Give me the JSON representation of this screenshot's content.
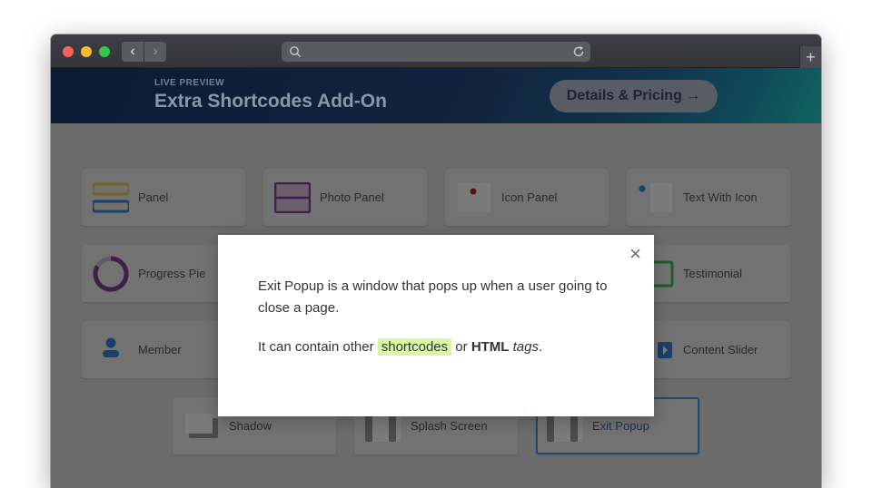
{
  "browser": {
    "nav_back": "‹",
    "nav_forward": "›",
    "new_tab": "+",
    "url_value": ""
  },
  "banner": {
    "kicker": "LIVE PREVIEW",
    "title": "Extra Shortcodes Add-On",
    "button_label": "Details & Pricing →"
  },
  "shortcodes": [
    {
      "label": "Panel",
      "icon": "panel-icon"
    },
    {
      "label": "Photo Panel",
      "icon": "photo-panel-icon"
    },
    {
      "label": "Icon Panel",
      "icon": "icon-panel-icon"
    },
    {
      "label": "Text With Icon",
      "icon": "text-with-icon-icon"
    },
    {
      "label": "Progress Pie",
      "icon": "progress-pie-icon"
    },
    {
      "label": "Testimonial",
      "icon": "testimonial-icon"
    },
    {
      "label": "Member",
      "icon": "member-icon"
    },
    {
      "label": "Content Slider",
      "icon": "content-slider-icon"
    },
    {
      "label": "Shadow",
      "icon": "shadow-icon"
    },
    {
      "label": "Splash Screen",
      "icon": "splash-screen-icon"
    },
    {
      "label": "Exit Popup",
      "icon": "exit-popup-icon",
      "active": true
    }
  ],
  "modal": {
    "close": "×",
    "p1": "Exit Popup is a window that pops up when a user going to close a page.",
    "p2_prefix": "It can contain other ",
    "p2_highlight": "shortcodes",
    "p2_mid": " or ",
    "p2_bold": "HTML",
    "p2_space": " ",
    "p2_italic": "tags",
    "p2_end": "."
  }
}
